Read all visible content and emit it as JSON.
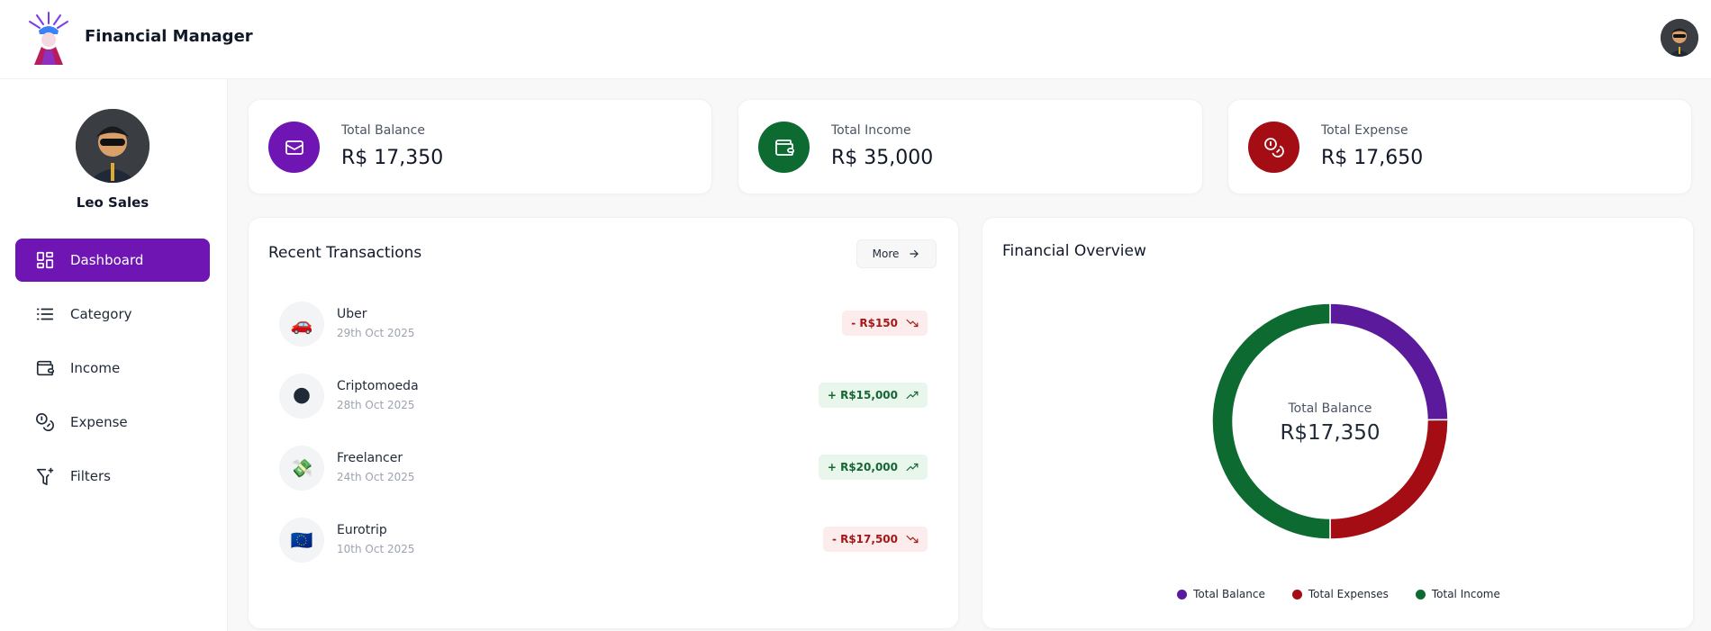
{
  "header": {
    "app_title": "Financial Manager"
  },
  "sidebar": {
    "user_name": "Leo Sales",
    "nav": [
      {
        "label": "Dashboard",
        "icon": "dashboard-icon",
        "active": true
      },
      {
        "label": "Category",
        "icon": "list-icon"
      },
      {
        "label": "Income",
        "icon": "wallet-icon"
      },
      {
        "label": "Expense",
        "icon": "coins-icon"
      },
      {
        "label": "Filters",
        "icon": "filter-plus-icon"
      }
    ]
  },
  "summary": [
    {
      "label": "Total Balance",
      "value": "R$ 17,350",
      "color": "#6f15b4",
      "icon": "card-icon"
    },
    {
      "label": "Total Income",
      "value": "R$ 35,000",
      "color": "#0d6b32",
      "icon": "wallet-icon"
    },
    {
      "label": "Total Expense",
      "value": "R$ 17,650",
      "color": "#a50d14",
      "icon": "coins-icon"
    }
  ],
  "transactions": {
    "title": "Recent Transactions",
    "more_label": "More",
    "items": [
      {
        "name": "Uber",
        "date": "29th Oct 2025",
        "amount": "- R$150",
        "type": "expense",
        "emoji": "🚗"
      },
      {
        "name": "Criptomoeda",
        "date": "28th Oct 2025",
        "amount": "+ R$15,000",
        "type": "income",
        "emoji": "🌑"
      },
      {
        "name": "Freelancer",
        "date": "24th Oct 2025",
        "amount": "+ R$20,000",
        "type": "income",
        "emoji": "💸"
      },
      {
        "name": "Eurotrip",
        "date": "10th Oct 2025",
        "amount": "- R$17,500",
        "type": "expense",
        "emoji": "🇪🇺"
      }
    ]
  },
  "overview": {
    "title": "Financial Overview",
    "center_label": "Total Balance",
    "center_value": "R$17,350"
  },
  "chart_data": {
    "type": "pie",
    "title": "Financial Overview",
    "categories": [
      "Total Balance",
      "Total Expenses",
      "Total Income"
    ],
    "values": [
      17350,
      17650,
      35000
    ],
    "colors": [
      "#5b1a9c",
      "#a50d14",
      "#0d6b32"
    ],
    "legend": "bottom"
  }
}
